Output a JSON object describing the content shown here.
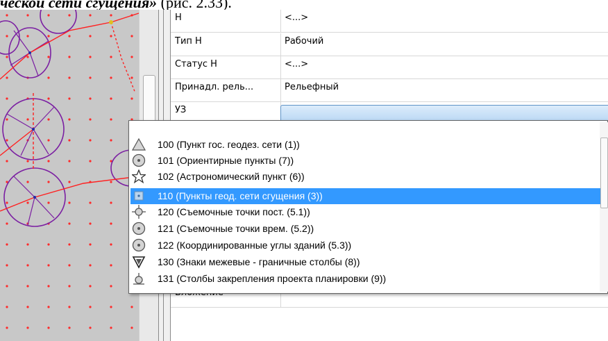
{
  "caption": {
    "italic_part": "ческой сети сгущения»",
    "rest": " (рис. 2.33)."
  },
  "properties": [
    {
      "key": "Н",
      "value": "<...>"
    },
    {
      "key": "Тип Н",
      "value": "Рабочий"
    },
    {
      "key": "Статус Н",
      "value": "<...>"
    },
    {
      "key": "Принадл. рель...",
      "value": "Рельефный"
    },
    {
      "key": "УЗ",
      "value": ""
    },
    {
      "key": "Вложение",
      "value": ""
    }
  ],
  "dropdown": {
    "selected_index": 3,
    "items": [
      {
        "label": "100 (Пункт гос. геодез. сети (1))",
        "icon": "triangle-icon"
      },
      {
        "label": "101 (Ориентирные пункты (7))",
        "icon": "circle-dot-icon"
      },
      {
        "label": "102 (Астрономический пункт (6))",
        "icon": "star-icon"
      },
      {
        "label": "110 (Пункты геод. сети сгущения (3))",
        "icon": "square-dot-icon"
      },
      {
        "label": "120 (Съемочные точки пост. (5.1))",
        "icon": "crosshair-icon"
      },
      {
        "label": "121 (Съемочные точки врем. (5.2))",
        "icon": "circle-dot-icon"
      },
      {
        "label": "122 (Координированные углы зданий (5.3))",
        "icon": "circle-dot-icon"
      },
      {
        "label": "130 (Знаки межевые - граничные столбы (8))",
        "icon": "down-triangle-icon"
      },
      {
        "label": "131 (Столбы закрепления проекта планировки (9))",
        "icon": "pillar-icon"
      }
    ]
  },
  "colors": {
    "accent": "#3399ff",
    "map_bg": "#c8c8c8",
    "circle": "#8a2be2",
    "line": "#ff2020"
  }
}
